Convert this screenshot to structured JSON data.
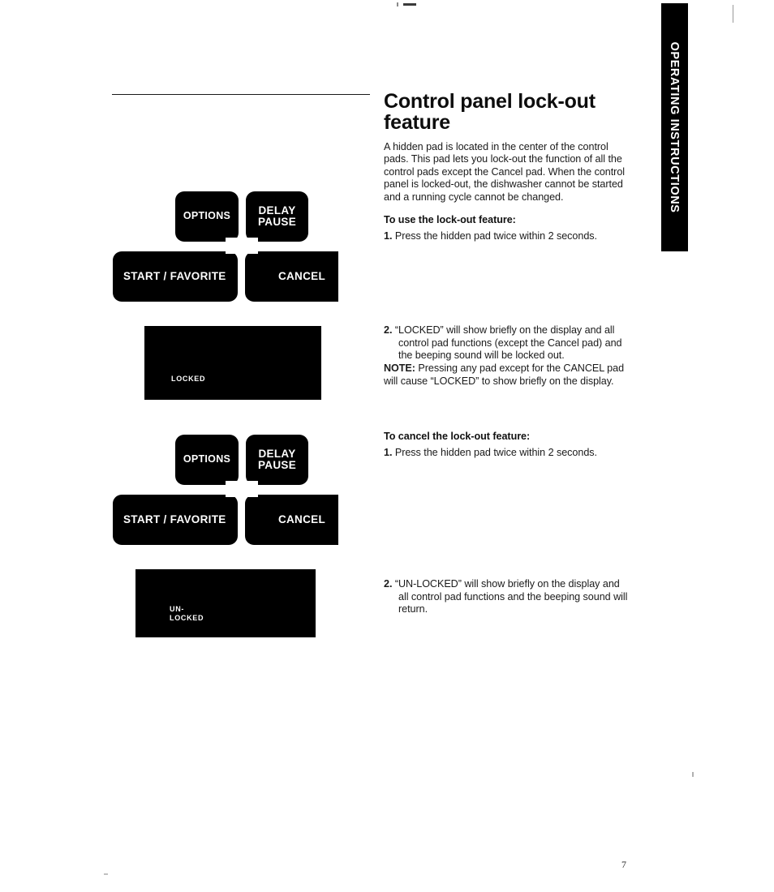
{
  "page": {
    "number": "7",
    "thumb_tab_label": "OPERATING INSTRUCTIONS"
  },
  "article": {
    "title": "Control panel lock-out feature",
    "intro": "A hidden pad is located in the center of the control pads. This pad lets you lock-out the function of all the control pads except the Cancel pad. When the control panel is locked-out, the dishwasher cannot be started and a running cycle cannot be changed.",
    "use_heading": "To use the lock-out feature:",
    "use_step_1_num": "1.",
    "use_step_1": "Press the hidden pad twice within 2 seconds.",
    "use_step_2_num": "2.",
    "use_step_2": "“LOCKED” will show briefly on the display and all control pad functions (except the Cancel pad) and the beeping sound will be locked out.",
    "note_label": "NOTE:",
    "note_text": " Pressing any pad except for the CANCEL pad will cause “LOCKED” to show briefly on the display.",
    "cancel_heading": "To cancel the lock-out feature:",
    "cancel_step_1_num": "1.",
    "cancel_step_1": "Press the hidden pad twice within 2 seconds.",
    "cancel_step_2_num": "2.",
    "cancel_step_2": "“UN-LOCKED” will show briefly on the display and all control pad functions and the beeping sound will return."
  },
  "control_panel": {
    "pads": {
      "options": "OPTIONS",
      "delay_pause_line1": "DELAY",
      "delay_pause_line2": "PAUSE",
      "start_favorite": "START / FAVORITE",
      "cancel": "CANCEL"
    },
    "hidden_pad_name": "hidden pad"
  },
  "displays": {
    "locked": "LOCKED",
    "unlocked": "UN-\nLOCKED"
  },
  "colors": {
    "pad_fill": "#000000",
    "pad_text": "#ffffff",
    "page_background": "#ffffff",
    "body_text": "#1a1a1a"
  }
}
